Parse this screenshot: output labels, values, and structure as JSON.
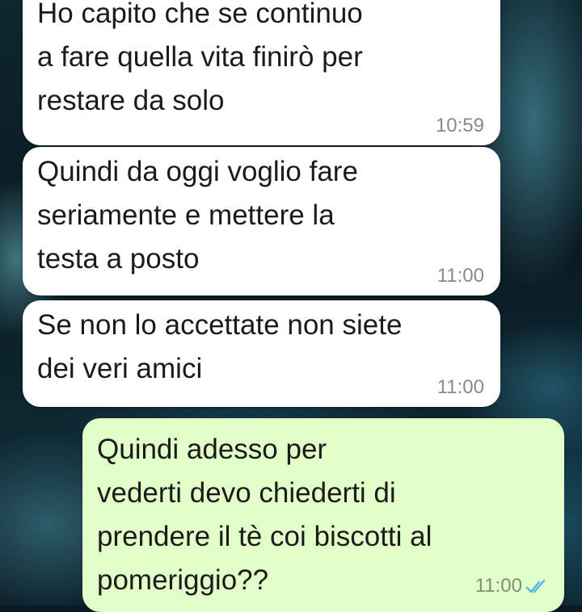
{
  "messages": [
    {
      "direction": "incoming",
      "text": "Ho capito che se continuo\na fare quella vita finirò per\nrestare da solo",
      "time": "10:59"
    },
    {
      "direction": "incoming",
      "text": "Quindi da oggi voglio fare\nseriamente e mettere la\ntesta a posto",
      "time": "11:00"
    },
    {
      "direction": "incoming",
      "text": "Se non lo accettate non siete\ndei veri amici",
      "time": "11:00"
    },
    {
      "direction": "outgoing",
      "text": "Quindi adesso per\nvederti devo chiederti di\nprendere il tè coi biscotti al\npomeriggio??",
      "time": "11:00",
      "status": "read"
    }
  ],
  "colors": {
    "incoming_bubble": "#ffffff",
    "outgoing_bubble": "#e2fec9",
    "read_ticks": "#4fb6ec",
    "timestamp": "#8a8a8a"
  },
  "icons": {
    "read_receipt": "double-check-icon"
  }
}
